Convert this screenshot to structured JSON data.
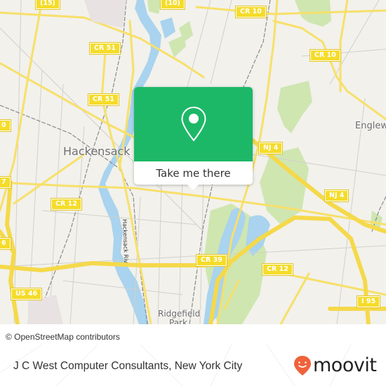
{
  "map": {
    "attribution": "© OpenStreetMap contributors",
    "road_labels": [
      {
        "id": "r15",
        "label": "(15)"
      },
      {
        "id": "r10a",
        "label": "(10)"
      },
      {
        "id": "cr10a",
        "label": "CR 10"
      },
      {
        "id": "cr10b",
        "label": "CR 10"
      },
      {
        "id": "cr51a",
        "label": "CR 51"
      },
      {
        "id": "cr51b",
        "label": "CR 51"
      },
      {
        "id": "nj4a",
        "label": "NJ 4"
      },
      {
        "id": "nj4b",
        "label": "NJ 4"
      },
      {
        "id": "cr12a",
        "label": "CR 12"
      },
      {
        "id": "cr12b",
        "label": "CR 12"
      },
      {
        "id": "cr39",
        "label": "CR 39"
      },
      {
        "id": "us46",
        "label": "US 46"
      },
      {
        "id": "i95",
        "label": "I 95"
      },
      {
        "id": "edge7",
        "label": "7"
      },
      {
        "id": "edge6",
        "label": "6"
      },
      {
        "id": "edge0",
        "label": "0"
      }
    ],
    "place_labels": {
      "hackensack": "Hackensack",
      "englewood": "Englew",
      "ridgefield": "Ridgefield",
      "park": "Park"
    },
    "river_label": "Hackensack Riv",
    "colors": {
      "land": "#f2f1ec",
      "road": "#f7e06a",
      "water": "#a9d3ee",
      "park": "#cfe6b1"
    }
  },
  "popup": {
    "icon": "map-pin-icon",
    "action_label": "Take me there",
    "accent_color": "#1db867"
  },
  "footer": {
    "title": "J C West Computer Consultants, New York City",
    "logo_icon": "moovit-smile-pin-icon",
    "logo_text": "moovit",
    "logo_color": "#f0623a"
  }
}
